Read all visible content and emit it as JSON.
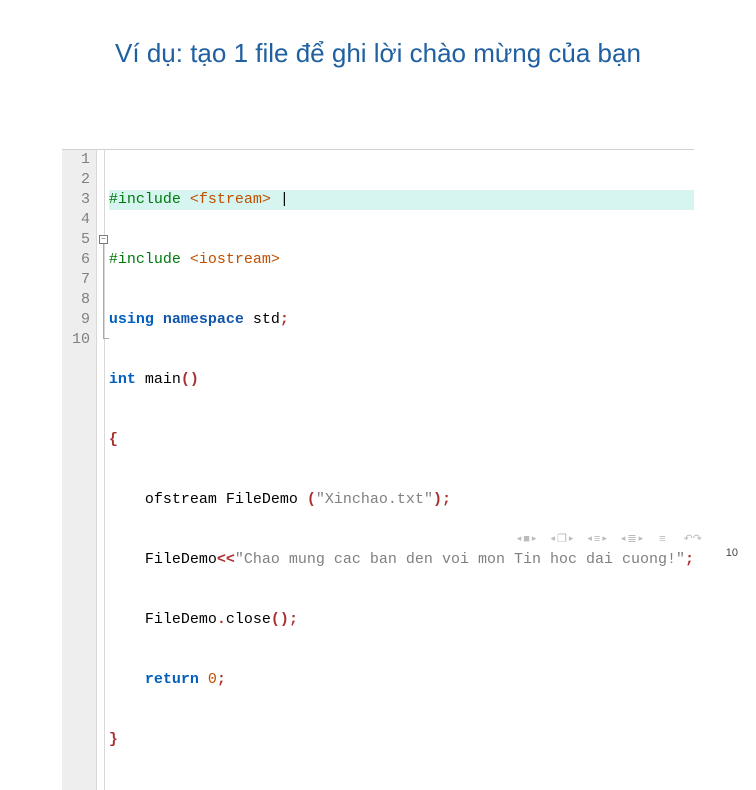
{
  "title": "Ví dụ: tạo 1 file để ghi lời chào mừng của bạn",
  "code": {
    "lines": [
      "1",
      "2",
      "3",
      "4",
      "5",
      "6",
      "7",
      "8",
      "9",
      "10"
    ],
    "l1": {
      "pre": "#include ",
      "hdr": "<fstream>",
      "cur": "|"
    },
    "l2": {
      "pre": "#include ",
      "hdr": "<iostream>"
    },
    "l3": {
      "kw": "using",
      "kw2": "namespace",
      "id": " std",
      "semi": ";"
    },
    "l4": {
      "kw": "int",
      "id": " main",
      "paren": "()"
    },
    "l5": {
      "brace": "{"
    },
    "l6": {
      "indent": "    ",
      "id1": "ofstream FileDemo ",
      "lp": "(",
      "str": "\"Xinchao.txt\"",
      "rps": ");"
    },
    "l7": {
      "indent": "    ",
      "id1": "FileDemo",
      "op": "<<",
      "str": "\"Chao mung cac ban den voi mon Tin hoc dai cuong!\"",
      "semi": ";"
    },
    "l8": {
      "indent": "    ",
      "id1": "FileDemo",
      "dot": ".",
      "id2": "close",
      "paren": "()",
      "semi": ";"
    },
    "l9": {
      "indent": "    ",
      "kw": "return",
      "sp": " ",
      "num": "0",
      "semi": ";"
    },
    "l10": {
      "brace": "}"
    }
  },
  "nav": {
    "g1": "■",
    "g2": "❐",
    "g3": "≡",
    "g4": "≣",
    "g5": "≡",
    "undo": "↶↷"
  },
  "pageNumber": "10"
}
